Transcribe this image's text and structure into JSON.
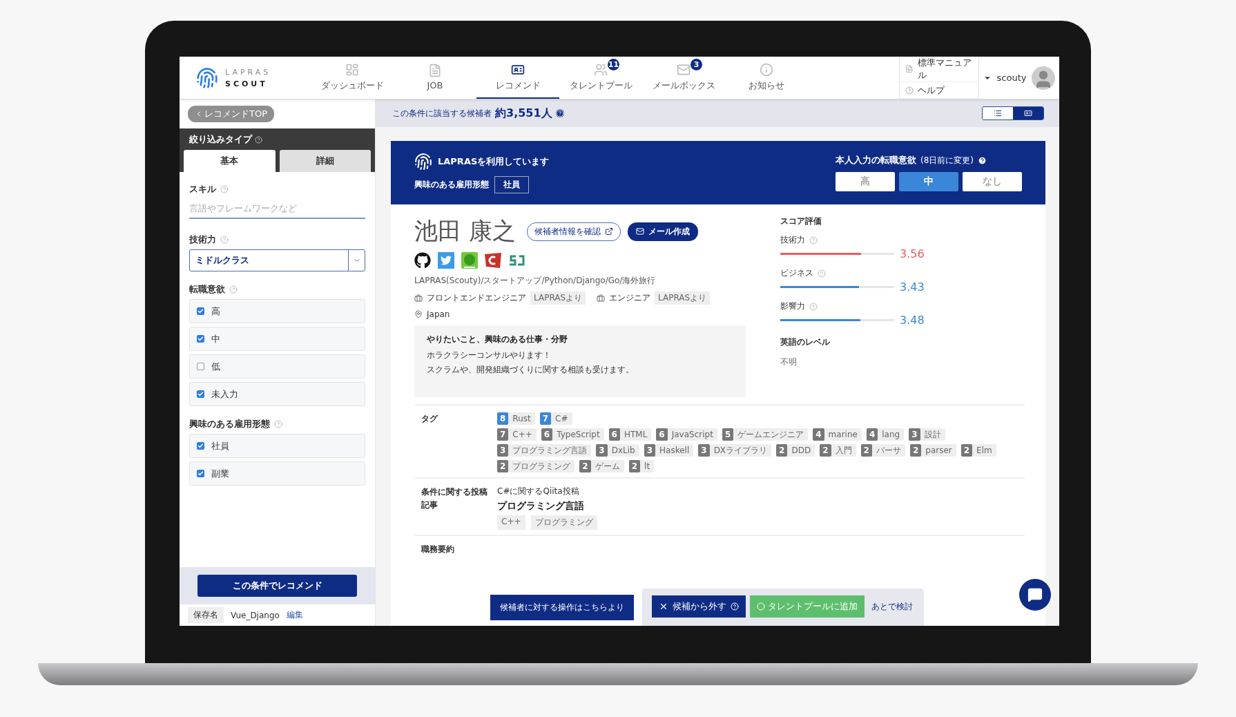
{
  "nav": {
    "logo_top": "LAPRAS",
    "logo_bottom": "SCOUT",
    "items": [
      {
        "kind": "dashboard",
        "label": "ダッシュボード",
        "selected": false
      },
      {
        "kind": "job",
        "label": "JOB",
        "selected": false
      },
      {
        "kind": "recommend",
        "label": "レコメンド",
        "selected": true
      },
      {
        "kind": "talent",
        "label": "タレントプール",
        "badge": "11",
        "selected": false
      },
      {
        "kind": "mail",
        "label": "メールボックス",
        "badge": "3",
        "selected": false
      },
      {
        "kind": "info",
        "label": "お知らせ",
        "selected": false
      }
    ],
    "links": [
      {
        "kind": "manual",
        "label": "標準マニュアル"
      },
      {
        "kind": "help",
        "label": "ヘルプ"
      }
    ],
    "user": "scouty"
  },
  "sidebar": {
    "back": "レコメンドTOP",
    "filter_title": "絞り込みタイプ",
    "tabs": [
      {
        "label": "基本",
        "selected": true
      },
      {
        "label": "詳細",
        "selected": false
      }
    ],
    "skill": {
      "label": "スキル",
      "placeholder": "言語やフレームワークなど"
    },
    "tech": {
      "label": "技術力",
      "value": "ミドルクラス"
    },
    "groups": [
      {
        "label": "転職意欲",
        "options": [
          {
            "label": "高",
            "checked": true
          },
          {
            "label": "中",
            "checked": true
          },
          {
            "label": "低",
            "checked": false
          },
          {
            "label": "未入力",
            "checked": true
          }
        ]
      },
      {
        "label": "興味のある雇用形態",
        "options": [
          {
            "label": "社員",
            "checked": true
          },
          {
            "label": "副業",
            "checked": true
          }
        ]
      }
    ],
    "submit": "この条件でレコメンド",
    "saved_label": "保存名",
    "saved_name": "Vue_Django",
    "edit": "編集"
  },
  "count_bar": {
    "text": "この条件に該当する候補者",
    "count": "約3,551人",
    "views": [
      {
        "kind": "list",
        "selected": false
      },
      {
        "kind": "card",
        "selected": true
      }
    ]
  },
  "candidate": {
    "banner": {
      "using": "LAPRASを利用しています",
      "employment_label": "興味のある雇用形態",
      "employment": "社員",
      "intent_title": "本人入力の転職意欲",
      "intent_note": "(8日前に変更)",
      "intent": [
        {
          "label": "高",
          "selected": false
        },
        {
          "label": "中",
          "selected": true
        },
        {
          "label": "なし",
          "selected": false
        }
      ]
    },
    "name": "池田 康之",
    "info_button": "候補者情報を確認",
    "mail_button": "メール作成",
    "bio": "LAPRAS(Scouty)/スタートアップ/Python/Django/Go/海外旅行",
    "roles": [
      {
        "title": "フロントエンドエンジニア",
        "source": "LAPRASより"
      },
      {
        "title": "エンジニア",
        "source": "LAPRASより"
      }
    ],
    "location": "Japan",
    "wish": {
      "title": "やりたいこと、興味のある仕事・分野",
      "lines": [
        "ホラクラシーコンサルやります！",
        "スクラムや、開発組織づくりに関する相談も受けます。"
      ]
    },
    "score_title": "スコア評価",
    "scores": [
      {
        "label": "技術力",
        "value": "3.56",
        "level": 0.71,
        "color": "#e85d5d"
      },
      {
        "label": "ビジネス",
        "value": "3.43",
        "level": 0.69,
        "color": "#3a86d8"
      },
      {
        "label": "影響力",
        "value": "3.48",
        "level": 0.7,
        "color": "#3a86d8"
      }
    ],
    "english_title": "英語のレベル",
    "english": "不明",
    "tags_label": "タグ",
    "tags": [
      [
        {
          "count": "8",
          "name": "Rust",
          "highlighted": true
        },
        {
          "count": "7",
          "name": "C#",
          "highlighted": true
        }
      ],
      [
        {
          "count": "7",
          "name": "C++",
          "highlighted": false
        },
        {
          "count": "6",
          "name": "TypeScript",
          "highlighted": false
        },
        {
          "count": "6",
          "name": "HTML",
          "highlighted": false
        },
        {
          "count": "6",
          "name": "JavaScript",
          "highlighted": false
        },
        {
          "count": "5",
          "name": "ゲームエンジニア",
          "highlighted": false
        },
        {
          "count": "4",
          "name": "marine",
          "highlighted": false
        },
        {
          "count": "4",
          "name": "lang",
          "highlighted": false
        },
        {
          "count": "3",
          "name": "設計",
          "highlighted": false
        }
      ],
      [
        {
          "count": "3",
          "name": "プログラミング言語",
          "highlighted": false
        },
        {
          "count": "3",
          "name": "DxLib",
          "highlighted": false
        },
        {
          "count": "3",
          "name": "Haskell",
          "highlighted": false
        },
        {
          "count": "3",
          "name": "DXライブラリ",
          "highlighted": false
        },
        {
          "count": "2",
          "name": "DDD",
          "highlighted": false
        },
        {
          "count": "2",
          "name": "入門",
          "highlighted": false
        },
        {
          "count": "2",
          "name": "パーサ",
          "highlighted": false
        },
        {
          "count": "2",
          "name": "parser",
          "highlighted": false
        },
        {
          "count": "2",
          "name": "Elm",
          "highlighted": false
        }
      ],
      [
        {
          "count": "2",
          "name": "プログラミング",
          "highlighted": false
        },
        {
          "count": "2",
          "name": "ゲーム",
          "highlighted": false
        },
        {
          "count": "2",
          "name": "lt",
          "highlighted": false
        }
      ]
    ],
    "posts": {
      "label": "条件に関する投稿記事",
      "source": "C#に関するQiita投稿",
      "title": "プログラミング言語",
      "tags": [
        "C++",
        "プログラミング"
      ]
    },
    "summary_label": "職務要約"
  },
  "actions": {
    "hint": "候補者に対する操作はこちらより",
    "remove": "候補から外す",
    "add": "タレントプールに追加",
    "later": "あとで検討"
  }
}
